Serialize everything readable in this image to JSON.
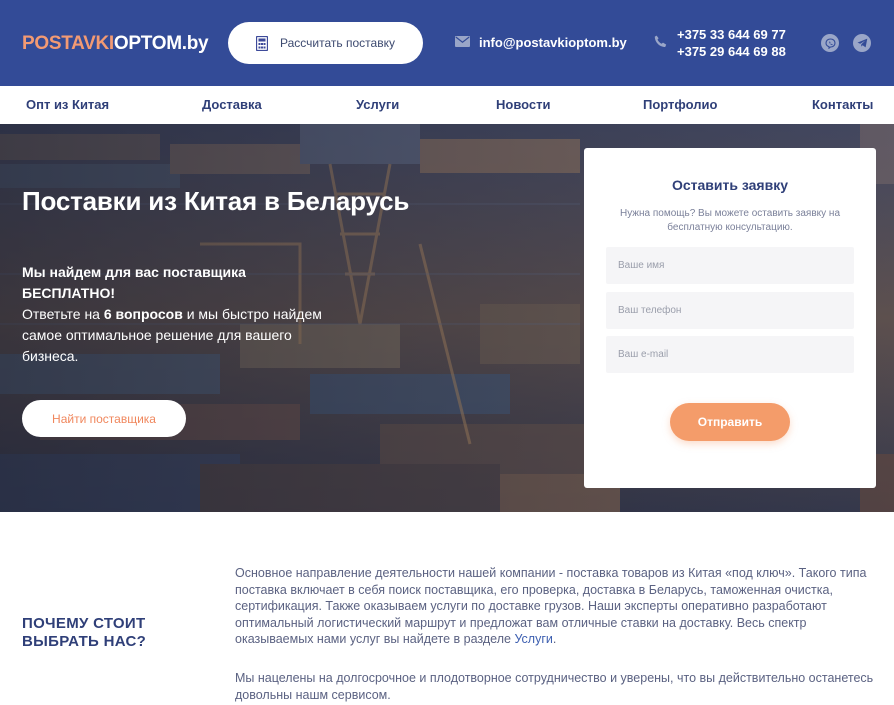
{
  "header": {
    "logo_part1": "POSTAVKI",
    "logo_part2": "OPTOM.by",
    "calc_button": "Рассчитать поставку",
    "email": "info@postavkioptom.by",
    "phone1": "+375 33 644 69 77",
    "phone2": "+375 29 644 69 88",
    "social_icons": [
      "viber-icon",
      "telegram-icon"
    ],
    "colors": {
      "header_bg": "#334b97",
      "accent": "#f39a73"
    }
  },
  "nav": {
    "items": [
      "Опт из Китая",
      "Доставка",
      "Услуги",
      "Новости",
      "Портфолио",
      "Контакты"
    ]
  },
  "hero": {
    "title": "Поставки из Китая в Беларусь",
    "lead_bold": "Мы найдем для вас поставщика БЕСПЛАТНО!",
    "text_before": "Ответьте на",
    "text_bold": "6 вопросов",
    "text_after": "и мы быстро найдем самое оптимальное решение для вашего бизнеса.",
    "find_button": "Найти поставщика"
  },
  "form": {
    "title": "Оставить заявку",
    "subtitle": "Нужна помощь? Вы можете оставить заявку на бесплатную консультацию.",
    "name_placeholder": "Ваше имя",
    "phone_placeholder": "Ваш телефон",
    "email_placeholder": "Ваш e-mail",
    "submit": "Отправить"
  },
  "about": {
    "heading_line1": "ПОЧЕМУ СТОИТ",
    "heading_line2": "ВЫБРАТЬ НАС?",
    "p1_text": "Основное направление деятельности нашей компании - поставка товаров из Китая «под ключ». Такого типа поставка включает в себя поиск поставщика, его проверка, доставка в Беларусь, таможенная очистка, сертификация. Также оказываем услуги по доставке грузов. Наши эксперты оперативно разработают оптимальный логистический маршрут и предложат вам отличные ставки на доставку. Весь спектр оказываемых нами услуг вы найдете в разделе",
    "p1_link": "Услуги",
    "p1_end": ".",
    "p2_text": "Мы нацелены на долгосрочное и плодотворное сотрудничество и уверены, что вы действительно останетесь довольны нашм сервисом."
  }
}
